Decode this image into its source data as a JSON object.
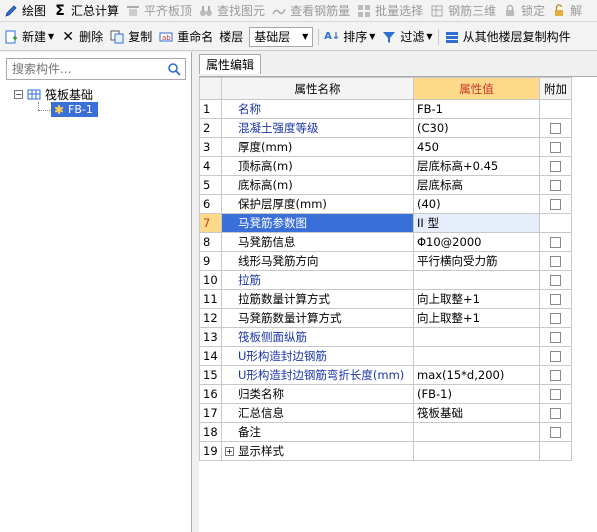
{
  "toolbar1": {
    "items": [
      {
        "label": "绘图",
        "icon": "pencil-icon",
        "disabled": false
      },
      {
        "label": "汇总计算",
        "icon": "sigma-icon",
        "disabled": false
      },
      {
        "label": "平齐板顶",
        "icon": "align-top-icon",
        "disabled": true
      },
      {
        "label": "查找图元",
        "icon": "binoculars-icon",
        "disabled": true
      },
      {
        "label": "查看钢筋量",
        "icon": "rebar-view-icon",
        "disabled": true
      },
      {
        "label": "批量选择",
        "icon": "batch-select-icon",
        "disabled": true
      },
      {
        "label": "钢筋三维",
        "icon": "rebar-3d-icon",
        "disabled": true
      },
      {
        "label": "锁定",
        "icon": "lock-icon",
        "disabled": true
      },
      {
        "label": "解",
        "icon": "unlock-icon",
        "disabled": true
      }
    ]
  },
  "toolbar2": {
    "new_label": "新建",
    "delete_label": "删除",
    "copy_label": "复制",
    "rename_label": "重命名",
    "floor_label": "楼层",
    "floor_value": "基础层",
    "sort_label": "排序",
    "filter_label": "过滤",
    "copy_from_floor_label": "从其他楼层复制构件"
  },
  "left": {
    "search_placeholder": "搜索构件...",
    "tree_root": "筏板基础",
    "tree_child": "FB-1"
  },
  "right": {
    "tab_label": "属性编辑",
    "headers": {
      "num": "",
      "name": "属性名称",
      "value": "属性值",
      "add": "附加"
    },
    "rows": [
      {
        "num": "1",
        "name": "名称",
        "value": "FB-1",
        "blue": true,
        "checkbox": false
      },
      {
        "num": "2",
        "name": "混凝土强度等级",
        "value": "(C30)",
        "blue": true,
        "checkbox": true
      },
      {
        "num": "3",
        "name": "厚度(mm)",
        "value": "450",
        "blue": false,
        "checkbox": true
      },
      {
        "num": "4",
        "name": "顶标高(m)",
        "value": "层底标高+0.45",
        "blue": false,
        "checkbox": true
      },
      {
        "num": "5",
        "name": "底标高(m)",
        "value": "层底标高",
        "blue": false,
        "checkbox": true
      },
      {
        "num": "6",
        "name": "保护层厚度(mm)",
        "value": "(40)",
        "blue": false,
        "checkbox": true
      },
      {
        "num": "7",
        "name": "马凳筋参数图",
        "value": "II 型",
        "blue": true,
        "checkbox": false,
        "selected": true
      },
      {
        "num": "8",
        "name": "马凳筋信息",
        "value": "Φ10@2000",
        "blue": false,
        "checkbox": true
      },
      {
        "num": "9",
        "name": "线形马凳筋方向",
        "value": "平行横向受力筋",
        "blue": false,
        "checkbox": true
      },
      {
        "num": "10",
        "name": "拉筋",
        "value": "",
        "blue": true,
        "checkbox": true
      },
      {
        "num": "11",
        "name": "拉筋数量计算方式",
        "value": "向上取整+1",
        "blue": false,
        "checkbox": true
      },
      {
        "num": "12",
        "name": "马凳筋数量计算方式",
        "value": "向上取整+1",
        "blue": false,
        "checkbox": true
      },
      {
        "num": "13",
        "name": "筏板侧面纵筋",
        "value": "",
        "blue": true,
        "checkbox": true
      },
      {
        "num": "14",
        "name": "U形构造封边钢筋",
        "value": "",
        "blue": true,
        "checkbox": true
      },
      {
        "num": "15",
        "name": "U形构造封边钢筋弯折长度(mm)",
        "value": "max(15*d,200)",
        "blue": true,
        "checkbox": true
      },
      {
        "num": "16",
        "name": "归类名称",
        "value": "(FB-1)",
        "blue": false,
        "checkbox": true
      },
      {
        "num": "17",
        "name": "汇总信息",
        "value": "筏板基础",
        "blue": false,
        "checkbox": true
      },
      {
        "num": "18",
        "name": "备注",
        "value": "",
        "blue": false,
        "checkbox": true
      },
      {
        "num": "19",
        "name": "显示样式",
        "value": "",
        "blue": false,
        "checkbox": false,
        "expandable": true
      }
    ]
  },
  "colors": {
    "selection": "#3a6fd9",
    "header_value_bg": "#ffd98a",
    "name_blue": "#1a36a8"
  }
}
